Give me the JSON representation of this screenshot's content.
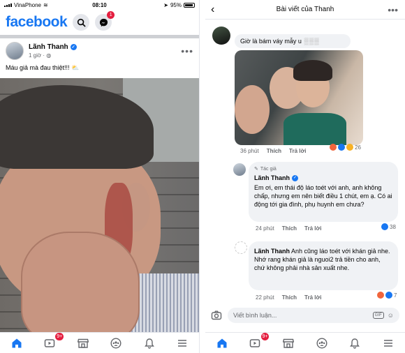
{
  "status": {
    "carrier": "VinaPhone",
    "time": "08:10",
    "battery": "95%"
  },
  "feed": {
    "logo": "facebook",
    "messenger_badge": "1",
    "post": {
      "author": "Lãnh Thanh",
      "time": "1 giờ ·",
      "caption": "Máu giả mà đau thiệt!!! ⛅"
    },
    "tabs": {
      "video_badge": "9+"
    }
  },
  "thread": {
    "title": "Bài viết của Thanh",
    "comment1": {
      "text": "Giờ là bám váy mẫy u",
      "time": "36 phút",
      "like": "Thích",
      "reply": "Trả lời",
      "reactions": "26"
    },
    "comment2": {
      "badge": "Tác giả",
      "author": "Lãnh Thanh",
      "text": "Em ơi, em thái độ láo toét với anh, anh không chấp, nhưng em nên biết điều 1 chút, em ạ. Có ai động tới gia đình, phụ huynh em chưa?",
      "time": "24 phút",
      "like": "Thích",
      "reply": "Trả lời",
      "reactions": "38"
    },
    "comment3": {
      "author": "Lãnh Thanh",
      "text": "Anh cũng láo toét với khán giả nhe. Nhớ rang khán giả là nguoi2 trả tiền cho anh, chứ không phải nhà sản xuất nhe.",
      "time": "22 phút",
      "like": "Thích",
      "reply": "Trả lời",
      "reactions": "7"
    },
    "composer": {
      "placeholder": "Viết bình luận...",
      "gif": "GIF"
    },
    "tabs": {
      "video_badge": "9+"
    }
  },
  "colors": {
    "brand": "#1877f2",
    "badge": "#e41e3f",
    "grey": "#65676b"
  }
}
